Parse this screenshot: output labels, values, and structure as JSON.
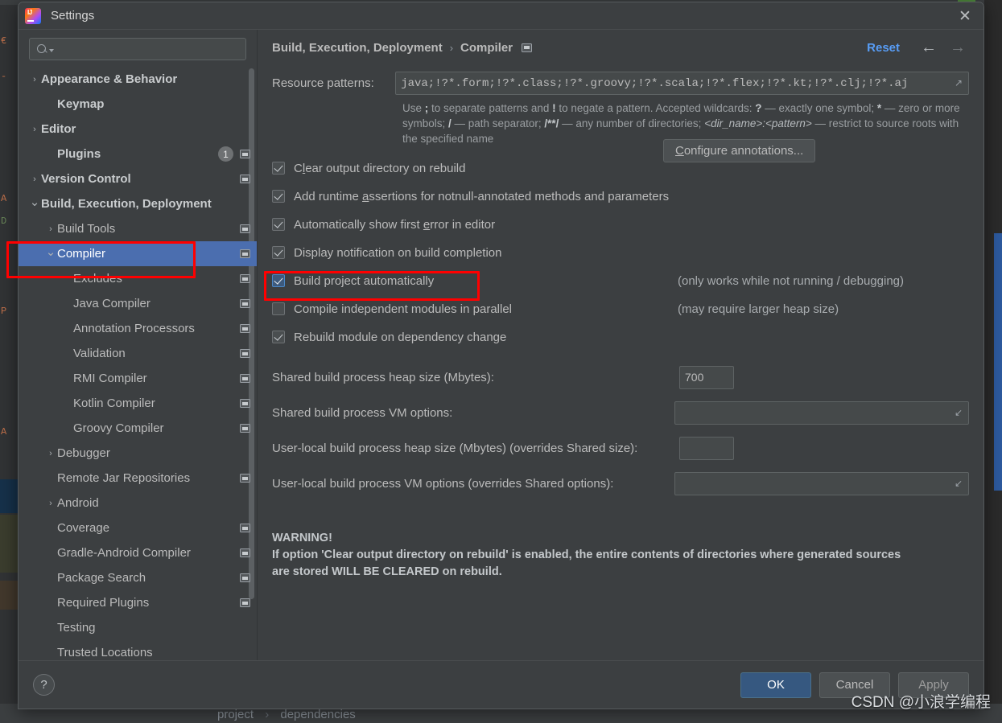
{
  "window": {
    "title": "Settings",
    "logo_icon": "intellij-idea-logo",
    "close_icon": "close-icon"
  },
  "search": {
    "value": "",
    "placeholder": "",
    "icon": "search-icon",
    "caret_icon": "chevron-down-icon"
  },
  "sidebar": {
    "items": [
      {
        "label": "Appearance & Behavior",
        "arrow": "chevron-right",
        "indent": 0,
        "bold": true,
        "scope": false,
        "badge": "",
        "selected": false
      },
      {
        "label": "Keymap",
        "arrow": "none",
        "indent": 1,
        "bold": true,
        "scope": false,
        "badge": "",
        "selected": false
      },
      {
        "label": "Editor",
        "arrow": "chevron-right",
        "indent": 0,
        "bold": true,
        "scope": false,
        "badge": "",
        "selected": false
      },
      {
        "label": "Plugins",
        "arrow": "none",
        "indent": 1,
        "bold": true,
        "scope": true,
        "badge": "1",
        "selected": false
      },
      {
        "label": "Version Control",
        "arrow": "chevron-right",
        "indent": 0,
        "bold": true,
        "scope": true,
        "badge": "",
        "selected": false
      },
      {
        "label": "Build, Execution, Deployment",
        "arrow": "chevron-down",
        "indent": 0,
        "bold": true,
        "scope": false,
        "badge": "",
        "selected": false
      },
      {
        "label": "Build Tools",
        "arrow": "chevron-right",
        "indent": 1,
        "bold": false,
        "scope": true,
        "badge": "",
        "selected": false
      },
      {
        "label": "Compiler",
        "arrow": "chevron-down",
        "indent": 1,
        "bold": false,
        "scope": true,
        "badge": "",
        "selected": true
      },
      {
        "label": "Excludes",
        "arrow": "none",
        "indent": 2,
        "bold": false,
        "scope": true,
        "badge": "",
        "selected": false
      },
      {
        "label": "Java Compiler",
        "arrow": "none",
        "indent": 2,
        "bold": false,
        "scope": true,
        "badge": "",
        "selected": false
      },
      {
        "label": "Annotation Processors",
        "arrow": "none",
        "indent": 2,
        "bold": false,
        "scope": true,
        "badge": "",
        "selected": false
      },
      {
        "label": "Validation",
        "arrow": "none",
        "indent": 2,
        "bold": false,
        "scope": true,
        "badge": "",
        "selected": false
      },
      {
        "label": "RMI Compiler",
        "arrow": "none",
        "indent": 2,
        "bold": false,
        "scope": true,
        "badge": "",
        "selected": false
      },
      {
        "label": "Kotlin Compiler",
        "arrow": "none",
        "indent": 2,
        "bold": false,
        "scope": true,
        "badge": "",
        "selected": false
      },
      {
        "label": "Groovy Compiler",
        "arrow": "none",
        "indent": 2,
        "bold": false,
        "scope": true,
        "badge": "",
        "selected": false
      },
      {
        "label": "Debugger",
        "arrow": "chevron-right",
        "indent": 1,
        "bold": false,
        "scope": false,
        "badge": "",
        "selected": false
      },
      {
        "label": "Remote Jar Repositories",
        "arrow": "none",
        "indent": 1,
        "bold": false,
        "scope": true,
        "badge": "",
        "selected": false
      },
      {
        "label": "Android",
        "arrow": "chevron-right",
        "indent": 1,
        "bold": false,
        "scope": false,
        "badge": "",
        "selected": false
      },
      {
        "label": "Coverage",
        "arrow": "none",
        "indent": 1,
        "bold": false,
        "scope": true,
        "badge": "",
        "selected": false
      },
      {
        "label": "Gradle-Android Compiler",
        "arrow": "none",
        "indent": 1,
        "bold": false,
        "scope": true,
        "badge": "",
        "selected": false
      },
      {
        "label": "Package Search",
        "arrow": "none",
        "indent": 1,
        "bold": false,
        "scope": true,
        "badge": "",
        "selected": false
      },
      {
        "label": "Required Plugins",
        "arrow": "none",
        "indent": 1,
        "bold": false,
        "scope": true,
        "badge": "",
        "selected": false
      },
      {
        "label": "Testing",
        "arrow": "none",
        "indent": 1,
        "bold": false,
        "scope": false,
        "badge": "",
        "selected": false
      },
      {
        "label": "Trusted Locations",
        "arrow": "none",
        "indent": 1,
        "bold": false,
        "scope": false,
        "badge": "",
        "selected": false
      }
    ]
  },
  "breadcrumb": {
    "parent": "Build, Execution, Deployment",
    "separator": "›",
    "current": "Compiler",
    "scope_icon": "project-scope-icon",
    "reset_label": "Reset",
    "back_icon": "arrow-left-icon",
    "forward_icon": "arrow-right-icon"
  },
  "main": {
    "resource_patterns_label": "Resource patterns:",
    "resource_patterns_value": "java;!?*.form;!?*.class;!?*.groovy;!?*.scala;!?*.flex;!?*.kt;!?*.clj;!?*.aj",
    "hint_line1_a": "Use ",
    "hint_semicolon": ";",
    "hint_line1_b": " to separate patterns and ",
    "hint_bang": "!",
    "hint_line1_c": " to negate a pattern. Accepted wildcards: ",
    "hint_question": "?",
    "hint_line1_d": " — exactly one symbol; ",
    "hint_star": "*",
    "hint_line1_e": " — zero or more symbols; ",
    "hint_slash": "/",
    "hint_line2_a": " — path separator; ",
    "hint_globstar": "/**/",
    "hint_line2_b": " — any number of directories; ",
    "hint_dirpattern": "<dir_name>:<pattern>",
    "hint_line2_c": " — restrict to source roots with the specified name",
    "checkboxes": [
      {
        "label_pre": "C",
        "label_mn": "l",
        "label_post": "ear output directory on rebuild",
        "checked": true,
        "accent": false,
        "note": ""
      },
      {
        "label_pre": "Add runtime ",
        "label_mn": "a",
        "label_post": "ssertions for notnull-annotated methods and parameters",
        "checked": true,
        "accent": false,
        "note": ""
      },
      {
        "label_pre": "Automatically show first ",
        "label_mn": "e",
        "label_post": "rror in editor",
        "checked": true,
        "accent": false,
        "note": ""
      },
      {
        "label_pre": "Display notification on build completion",
        "label_mn": "",
        "label_post": "",
        "checked": true,
        "accent": false,
        "note": ""
      },
      {
        "label_pre": "Build project automatically",
        "label_mn": "",
        "label_post": "",
        "checked": true,
        "accent": true,
        "note": "(only works while not running / debugging)"
      },
      {
        "label_pre": "Compile independent modules in parallel",
        "label_mn": "",
        "label_post": "",
        "checked": false,
        "accent": false,
        "note": "(may require larger heap size)"
      },
      {
        "label_pre": "Rebuild module on dependency change",
        "label_mn": "",
        "label_post": "",
        "checked": true,
        "accent": false,
        "note": ""
      }
    ],
    "configure_annotations_label_pre": "",
    "configure_annotations_label_mn": "C",
    "configure_annotations_label_post": "onfigure annotations...",
    "fields": [
      {
        "label": "Shared build process heap size (Mbytes):",
        "value": "700",
        "wide": false,
        "expand": false
      },
      {
        "label": "Shared build process VM options:",
        "value": "",
        "wide": true,
        "expand": true
      },
      {
        "label": "User-local build process heap size (Mbytes) (overrides Shared size):",
        "value": "",
        "wide": false,
        "expand": false
      },
      {
        "label": "User-local build process VM options (overrides Shared options):",
        "value": "",
        "wide": true,
        "expand": true
      }
    ],
    "warning_title": "WARNING!",
    "warning_line1": "If option 'Clear output directory on rebuild' is enabled, the entire contents of directories where generated sources",
    "warning_line2": "are stored WILL BE CLEARED on rebuild."
  },
  "footer": {
    "help_label": "?",
    "ok_label": "OK",
    "cancel_label": "Cancel",
    "apply_label": "Apply"
  },
  "background": {
    "crumb_left": "project",
    "crumb_sep": "›",
    "crumb_right": "dependencies"
  },
  "watermark": {
    "text": "CSDN @小浪学编程"
  },
  "colors": {
    "accent_blue": "#4b6eaf",
    "link_blue": "#589df6",
    "primary_button": "#365880",
    "annotation_red": "#ff0000",
    "panel_bg": "#3c3f41"
  }
}
